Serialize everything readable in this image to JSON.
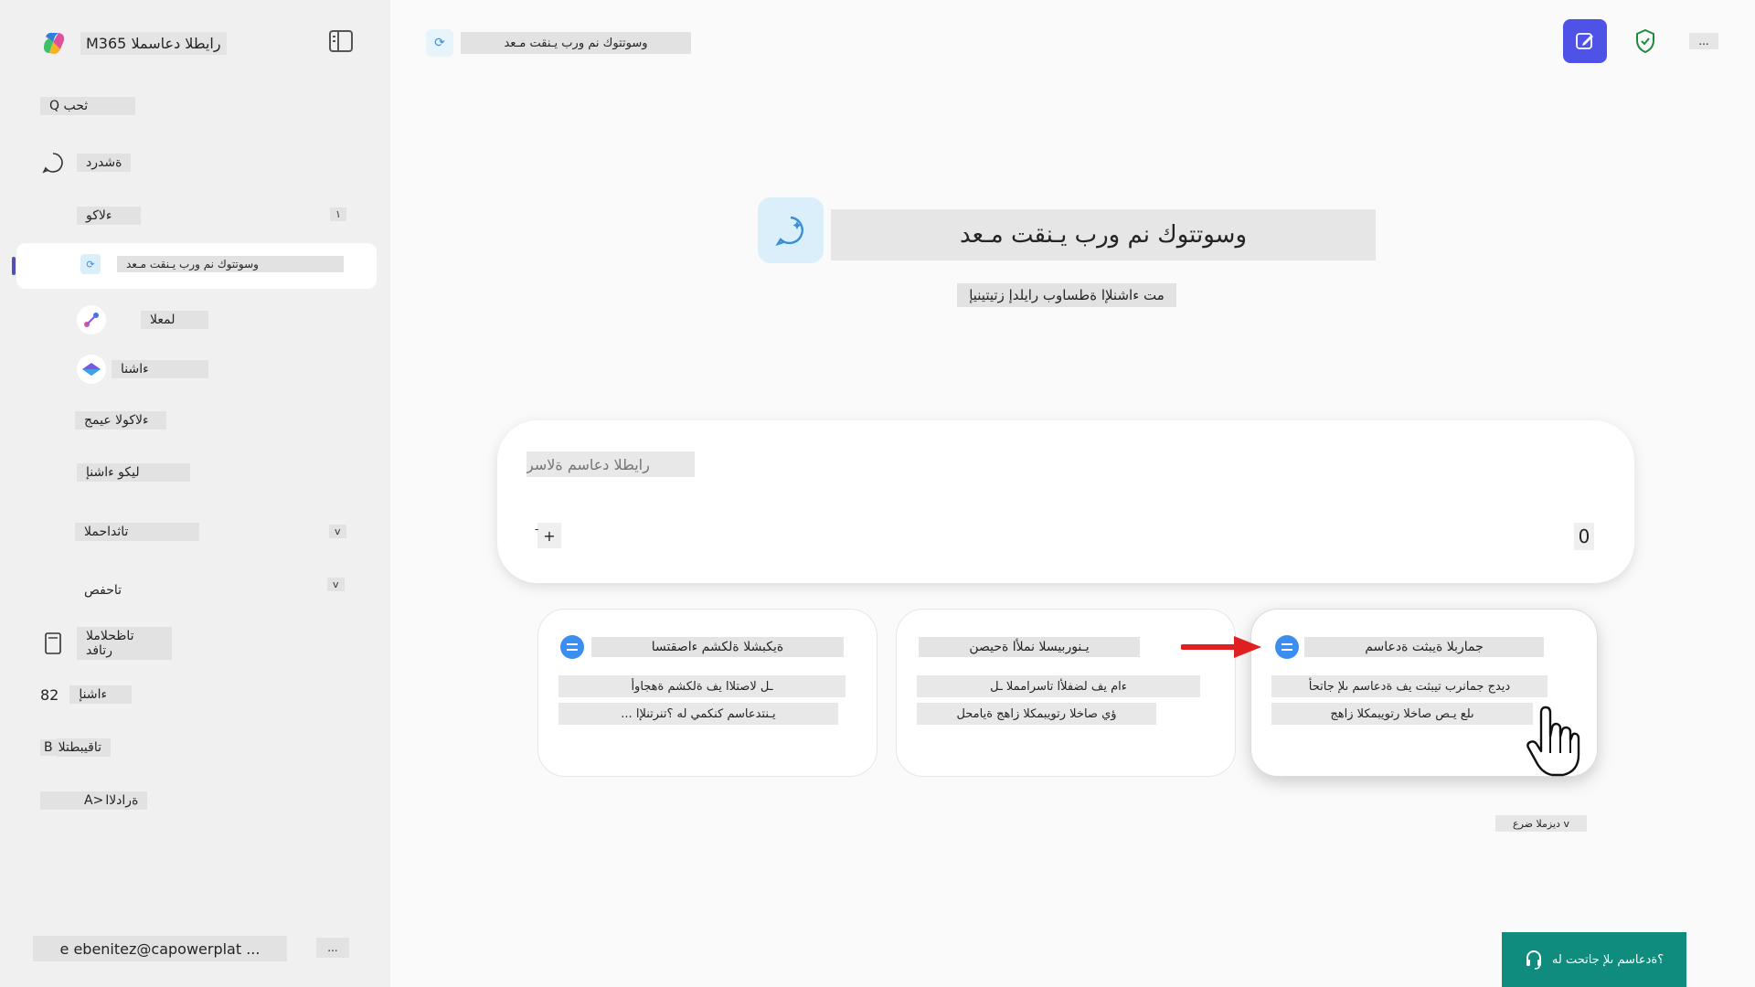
{
  "app": {
    "title": "M365 رايطلا دعاسملا"
  },
  "sidebar": {
    "items": [
      {
        "id": "search",
        "label": "Q ثحب"
      },
      {
        "id": "chat",
        "label": "ةشدرد"
      },
      {
        "id": "agents",
        "label": "ءلاكو",
        "count": "١"
      },
      {
        "id": "active-agent",
        "label": "وسوتتوك نم ورب يـنقت مـعد"
      },
      {
        "id": "workflow",
        "label": "لمعلا"
      },
      {
        "id": "create",
        "label": "ءاشنا"
      },
      {
        "id": "all-agents",
        "label": "ءلاكولا عيمج"
      },
      {
        "id": "create-agent",
        "label": "ليكو ءاشنإ"
      },
      {
        "id": "conversations",
        "label": "تاثداحملا",
        "chevron": "v"
      },
      {
        "id": "pages",
        "label": "تاحفص",
        "chevron": "v"
      },
      {
        "id": "notebooks",
        "label": "تاظحلاملا رتافد"
      },
      {
        "id": "create2",
        "label": "ءاشنإ",
        "prefix": "82"
      },
      {
        "id": "apps",
        "label": "تاقيبطتلا",
        "prefix": "B"
      },
      {
        "id": "admin",
        "label": "ةرادلاا",
        "prefix": "A>"
      }
    ],
    "user": {
      "email": "e ebenitez@capowerplat ...",
      "more": "..."
    }
  },
  "topbar": {
    "title": "وسوتتوك نم ورب يـنقت مـعد",
    "more": "..."
  },
  "hero": {
    "title": "وسوتتوك نم ورب يـنقت مـعد",
    "subtitle": "مت ءاشنلإا ةطساوب رايلدإ زتيتينيإ"
  },
  "composer": {
    "placeholder": "رايطلا دعاسم ةلاسر",
    "add": "+",
    "minus": "-",
    "counter": "0"
  },
  "cards": [
    {
      "title": "ةيكبشلا ةلكشم ءاصقتسا",
      "lines": [
        "ـل لاصتلاا يف ةلكشم ةهجاوأ",
        "... يـنتدعاسم كنكمي له ؟تنرتنلإا"
      ]
    },
    {
      "title": "يـنوربيسلا نملأا ةحيصن",
      "lines": [
        "ءام يف لضفلأا تاسرامملا ـل",
        "ؤي صاخلا رتويبمكلا زاهج ةيامحل"
      ]
    },
    {
      "title": "جماربلا ةيبثت ةدعاسم",
      "lines": [
        "ديدج جمانرب تيبثت يف ةدعاسم ىلإ جاتحأ",
        "ىلع يـص صاخلا رتويبمكلا زاهج"
      ]
    }
  ],
  "see_more": "ديزملا ضرع v",
  "help_button": "؟ةدعاسم ىلإ جاتحت له",
  "colors": {
    "accent": "#4f52e6",
    "help": "#0f8c7d",
    "arrow": "#e02020",
    "card_icon": "#3b8ef0"
  }
}
